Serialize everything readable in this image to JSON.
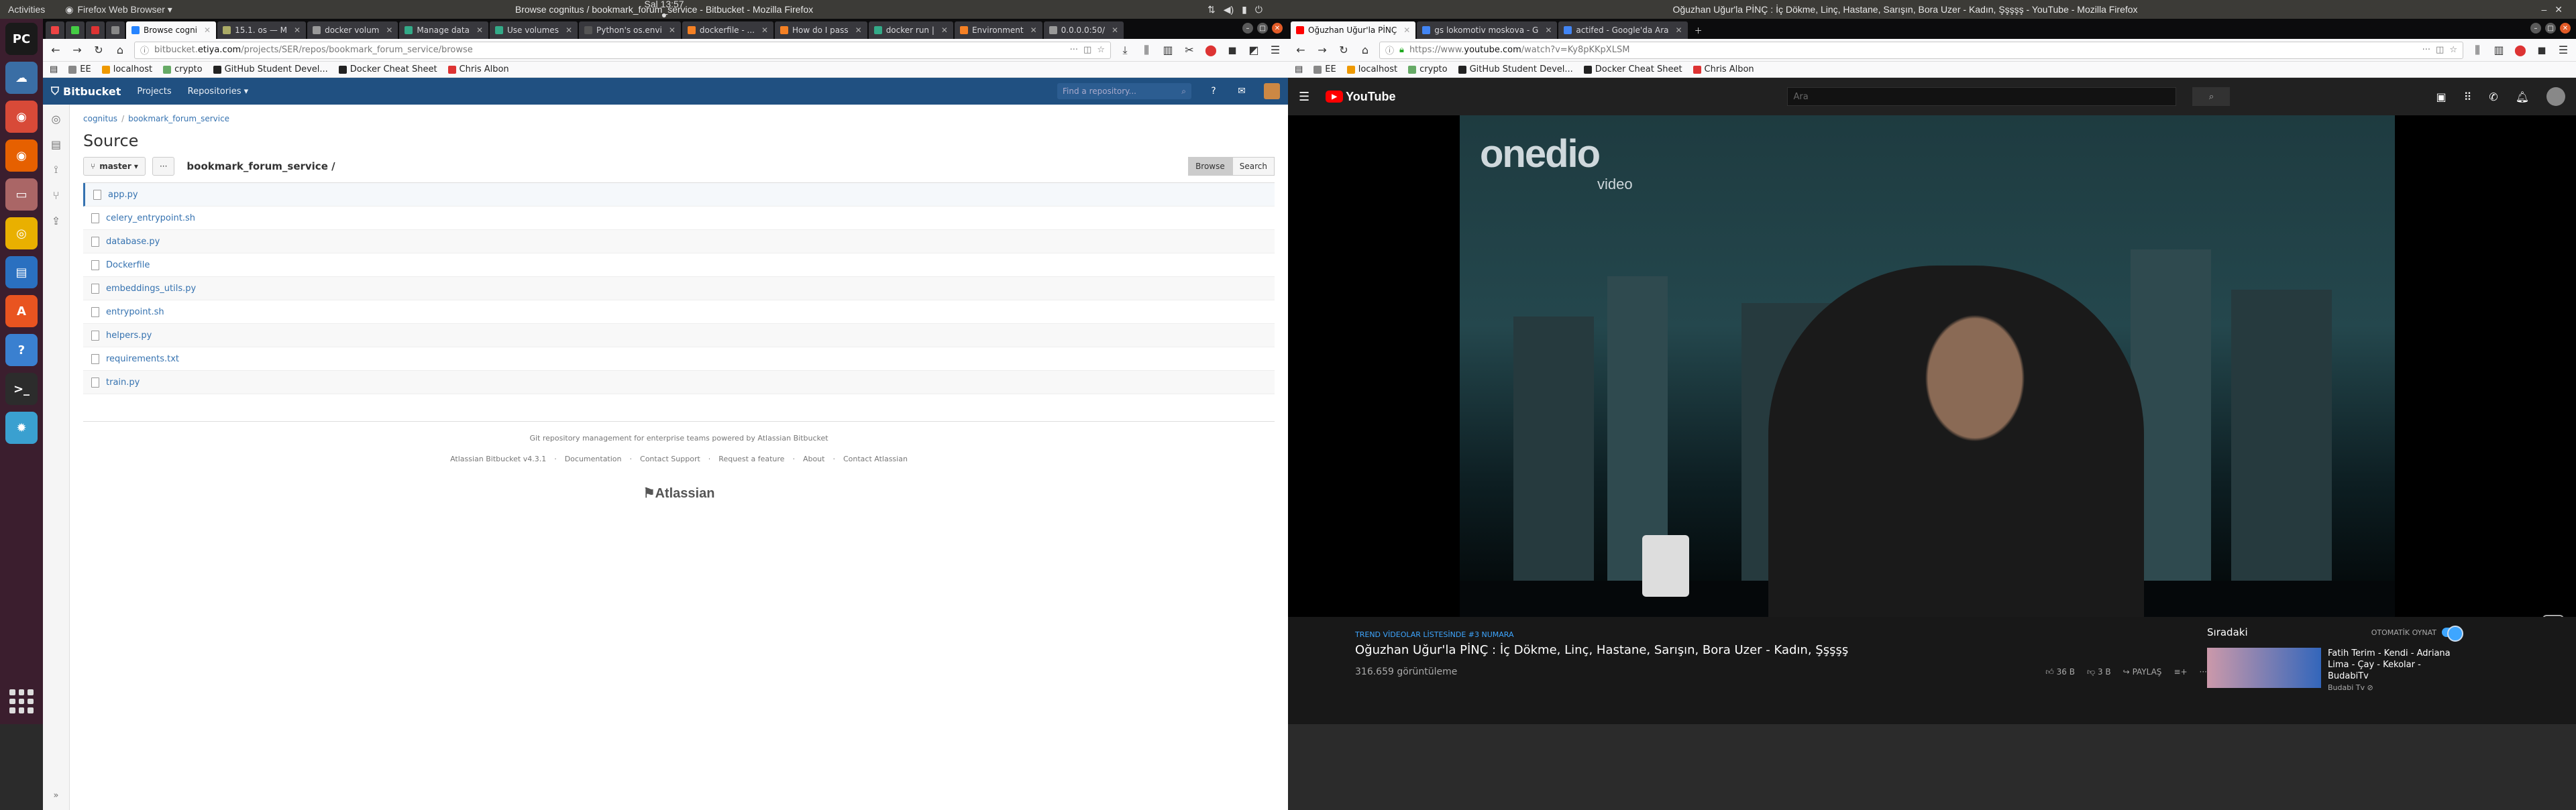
{
  "topbar": {
    "activities": "Activities",
    "app": "Firefox Web Browser ▾",
    "clock": "Sal 13:57 ●",
    "left_title": "Browse cognitus / bookmark_forum_service - Bitbucket - Mozilla Firefox",
    "right_title": "Oğuzhan Uğur'la PİNÇ : İç Dökme, Linç, Hastane, Sarışın, Bora Uzer - Kadın, Şşşşş - YouTube - Mozilla Firefox"
  },
  "dock": [
    {
      "name": "pycharm-icon",
      "label": "PC",
      "color": "#1a1a1a"
    },
    {
      "name": "cloud-icon",
      "label": "☁",
      "color": "#3a6ea5"
    },
    {
      "name": "chrome-icon",
      "label": "◉",
      "color": "#d84a38"
    },
    {
      "name": "firefox-icon",
      "label": "◉",
      "color": "#e66000"
    },
    {
      "name": "files-icon",
      "label": "▭",
      "color": "#a66"
    },
    {
      "name": "rhythmbox-icon",
      "label": "◎",
      "color": "#e9b000"
    },
    {
      "name": "writer-icon",
      "label": "▤",
      "color": "#2a70c0"
    },
    {
      "name": "software-icon",
      "label": "A",
      "color": "#e95420"
    },
    {
      "name": "help-icon",
      "label": "?",
      "color": "#3a80d0"
    },
    {
      "name": "terminal-icon",
      "label": ">_",
      "color": "#2c2c2c"
    },
    {
      "name": "settings-icon",
      "label": "✹",
      "color": "#3aa0d0"
    }
  ],
  "left": {
    "tabs": [
      {
        "label": "",
        "color": "#e44"
      },
      {
        "label": "",
        "color": "#4c4"
      },
      {
        "label": "",
        "color": "#d33"
      },
      {
        "label": "",
        "color": "#888"
      },
      {
        "label": "Browse cogni",
        "color": "#2684ff",
        "active": true
      },
      {
        "label": "15.1. os — M",
        "color": "#aa6"
      },
      {
        "label": "docker volum",
        "color": "#999"
      },
      {
        "label": "Manage data",
        "color": "#3a8"
      },
      {
        "label": "Use volumes",
        "color": "#3a8"
      },
      {
        "label": "Python's os.envi",
        "color": "#555"
      },
      {
        "label": "dockerfile - ...",
        "color": "#f48024"
      },
      {
        "label": "How do I pass",
        "color": "#f48024"
      },
      {
        "label": "docker run |",
        "color": "#3a8"
      },
      {
        "label": "Environment",
        "color": "#f48024"
      },
      {
        "label": "0.0.0.0:50/",
        "color": "#999"
      }
    ],
    "url_prefix": "bitbucket.",
    "url_host": "etiya.com",
    "url_rest": "/projects/SER/repos/bookmark_forum_service/browse",
    "bookmarks": [
      {
        "label": "EE",
        "color": "#888"
      },
      {
        "label": "localhost",
        "color": "#e90"
      },
      {
        "label": "crypto",
        "color": "#6a6"
      },
      {
        "label": "GitHub Student Devel...",
        "color": "#222"
      },
      {
        "label": "Docker Cheat Sheet",
        "color": "#222"
      },
      {
        "label": "Chris Albon",
        "color": "#d33"
      }
    ],
    "bb": {
      "logo": "Bitbucket",
      "nav": [
        "Projects",
        "Repositories ▾"
      ],
      "search_placeholder": "Find a repository...",
      "crumbs": [
        "cognitus",
        "bookmark_forum_service"
      ],
      "title": "Source",
      "branch": "master ▾",
      "more": "···",
      "path": "bookmark_forum_service /",
      "browse": "Browse",
      "search": "Search",
      "files": [
        "app.py",
        "celery_entrypoint.sh",
        "database.py",
        "Dockerfile",
        "embeddings_utils.py",
        "entrypoint.sh",
        "helpers.py",
        "requirements.txt",
        "train.py"
      ],
      "footer_line": "Git repository management for enterprise teams powered by Atlassian Bitbucket",
      "footer_links": [
        "Atlassian Bitbucket v4.3.1",
        "·",
        "Documentation",
        "·",
        "Contact Support",
        "·",
        "Request a feature",
        "·",
        "About",
        "·",
        "Contact Atlassian"
      ],
      "atlassian": "⚑Atlassian"
    }
  },
  "right": {
    "tabs": [
      {
        "label": "Oğuzhan Uğur'la PİNÇ",
        "color": "#f00",
        "active": true
      },
      {
        "label": "gs lokomotiv moskova - G",
        "color": "#4285f4"
      },
      {
        "label": "actifed - Google'da Ara",
        "color": "#4285f4"
      }
    ],
    "url_prefix": "https://www.",
    "url_host": "youtube.com",
    "url_rest": "/watch?v=Ky8pKKpXLSM",
    "bookmarks": [
      {
        "label": "EE",
        "color": "#888"
      },
      {
        "label": "localhost",
        "color": "#e90"
      },
      {
        "label": "crypto",
        "color": "#6a6"
      },
      {
        "label": "GitHub Student Devel...",
        "color": "#222"
      },
      {
        "label": "Docker Cheat Sheet",
        "color": "#222"
      },
      {
        "label": "Chris Albon",
        "color": "#d33"
      }
    ],
    "yt": {
      "logo": "YouTube",
      "search_placeholder": "Ara",
      "watermark": "onedio",
      "watermark_sub": "video",
      "trend_tag": "TREND VİDEOLAR LİSTESİNDE #3 NUMARA",
      "video_title": "Oğuzhan Uğur'la PİNÇ : İç Dökme, Linç, Hastane, Sarışın, Bora Uzer - Kadın, Şşşşş",
      "views": "316.659 görüntüleme",
      "likes": "36 B",
      "dislikes": "3 B",
      "share": "PAYLAŞ",
      "next_label": "Sıradaki",
      "autoplay_label": "OTOMATİK OYNAT",
      "next_title": "Fatih Terim - Kendi - Adriana Lima - Çay - Kekolar - BudabiTv",
      "next_channel": "Budabi Tv ⊘"
    }
  }
}
